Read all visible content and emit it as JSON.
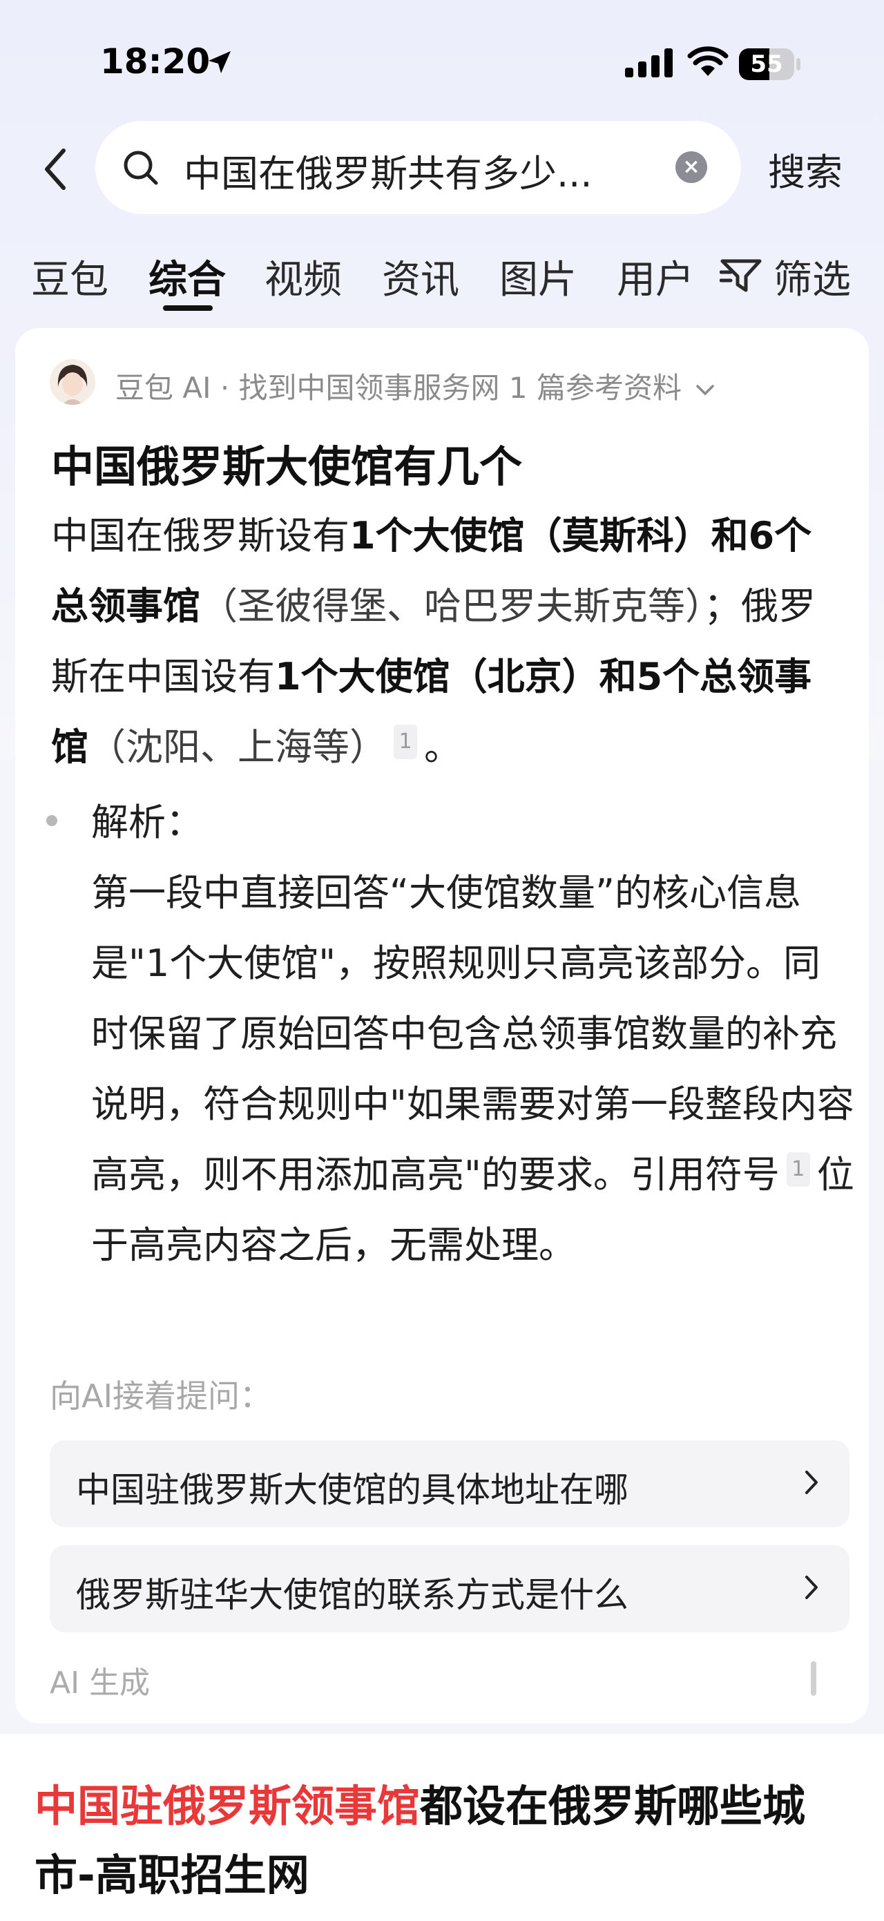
{
  "status_bar": {
    "time": "18:20",
    "battery_level": "55",
    "battery_fraction": 0.55
  },
  "search": {
    "query": "中国在俄罗斯共有多少...",
    "submit_label": "搜索"
  },
  "tabs": [
    {
      "label": "豆包",
      "active": false
    },
    {
      "label": "综合",
      "active": true
    },
    {
      "label": "视频",
      "active": false
    },
    {
      "label": "资讯",
      "active": false
    },
    {
      "label": "图片",
      "active": false
    },
    {
      "label": "用户",
      "active": false
    }
  ],
  "filter_label": "筛选",
  "ai_answer": {
    "source": "豆包 AI · 找到中国领事服务网 1 篇参考资料",
    "title": "中国俄罗斯大使馆有几个",
    "p1": "中国在俄罗斯设有",
    "p1_b1": "1个大使馆（莫斯科）和6个总领事馆",
    "p1_m1": "（圣彼得堡、哈巴罗夫斯克等）",
    "p1_t2": "；俄罗斯在中国设有",
    "p1_b2": "1个大使馆（北京）和5个总领事馆",
    "p1_m2": "（沈阳、上海等）",
    "citation": "1",
    "p1_end": "。",
    "analysis_label": "解析：",
    "analysis_1": "第一段中直接回答“大使馆数量”的核心信息是\"1个大使馆\"，按照规则只高亮该部分。同时保留了原始回答中包含总领事馆数量的补充说明，符合规则中\"如果需要对第一段整段内容高亮，则不用添加高亮\"的要求。引用符号",
    "analysis_cite": "1",
    "analysis_2": "位于高亮内容之后，无需处理。",
    "followup_label": "向AI接着提问：",
    "suggestions": [
      "中国驻俄罗斯大使馆的具体地址在哪",
      "俄罗斯驻华大使馆的联系方式是什么"
    ],
    "footer": "AI 生成"
  },
  "result": {
    "title_highlight": "中国驻俄罗斯领事馆",
    "title_rest": "都设在俄罗斯哪些城市-高职招生网"
  }
}
